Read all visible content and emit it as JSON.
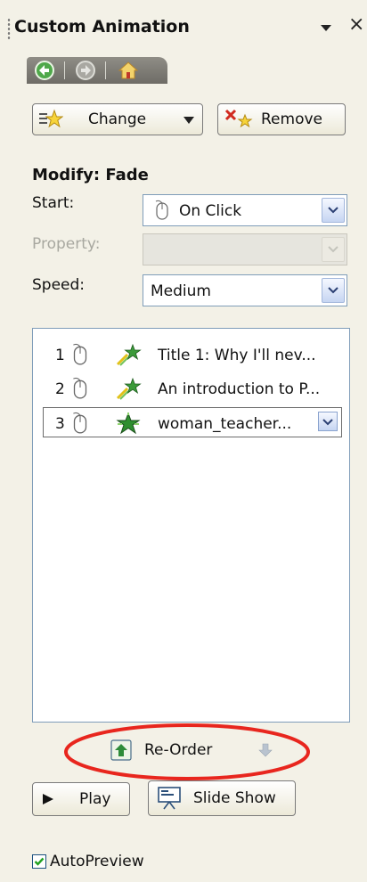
{
  "window": {
    "title": "Custom Animation",
    "close_glyph": "×"
  },
  "nav": {
    "back_icon": "back-arrow-icon",
    "forward_icon": "forward-arrow-icon",
    "home_icon": "home-icon"
  },
  "toolbar": {
    "change_label": "Change",
    "remove_label": "Remove"
  },
  "modify": {
    "heading": "Modify: Fade",
    "start_label": "Start:",
    "start_value": "On Click",
    "property_label": "Property:",
    "property_value": "",
    "speed_label": "Speed:",
    "speed_value": "Medium"
  },
  "animation_list": [
    {
      "num": "1",
      "text": "Title 1: Why I'll nev..."
    },
    {
      "num": "2",
      "text": "An introduction to P..."
    },
    {
      "num": "3",
      "text": "woman_teacher..."
    }
  ],
  "reorder": {
    "label": "Re-Order"
  },
  "actions": {
    "play_label": "Play",
    "slideshow_label": "Slide Show"
  },
  "autopreview": {
    "label": "AutoPreview",
    "checked": true
  },
  "colors": {
    "pane_bg": "#f3f1e7",
    "highlight_ellipse": "#e8261e",
    "nav_bar": "#7d7b75",
    "field_border": "#7f9db9"
  }
}
